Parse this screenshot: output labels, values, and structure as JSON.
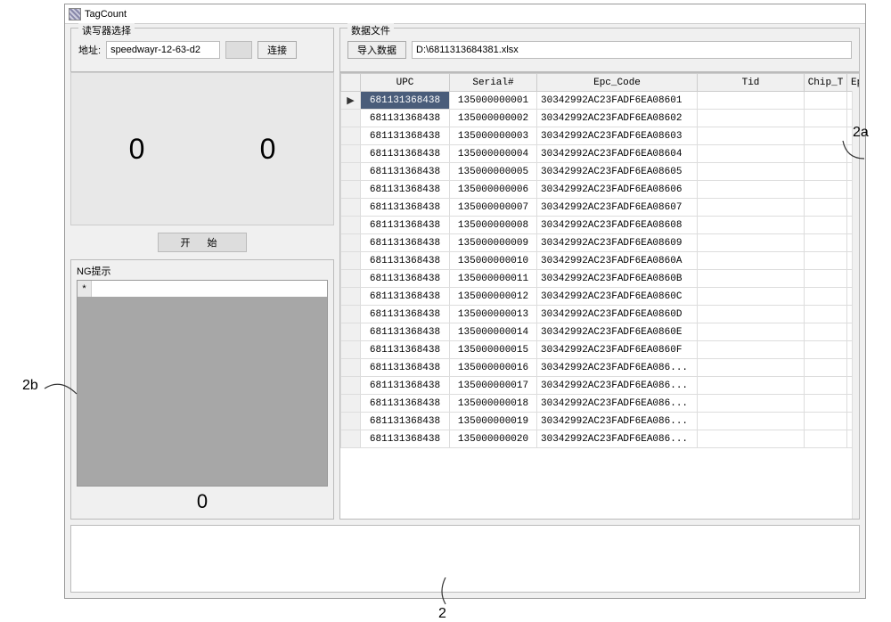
{
  "window": {
    "title": "TagCount"
  },
  "reader": {
    "group_label": "读写器选择",
    "addr_label": "地址:",
    "addr_value": "speedwayr-12-63-d2",
    "connect_label": "连接"
  },
  "datafile": {
    "group_label": "数据文件",
    "import_label": "导入数据",
    "path_value": "D:\\6811313684381.xlsx"
  },
  "counts": {
    "left": "0",
    "right": "0"
  },
  "start_label": "开  始",
  "ng": {
    "title": "NG提示",
    "count": "0",
    "marker": "*"
  },
  "grid": {
    "columns": [
      "",
      "UPC",
      "Serial#",
      "Epc_Code",
      "Tid",
      "Chip_T",
      "Epc_L"
    ],
    "rows": [
      {
        "marker": "▶",
        "upc": "681131368438",
        "serial": "135000000001",
        "epc": "30342992AC23FADF6EA08601",
        "sel": true
      },
      {
        "marker": "",
        "upc": "681131368438",
        "serial": "135000000002",
        "epc": "30342992AC23FADF6EA08602"
      },
      {
        "marker": "",
        "upc": "681131368438",
        "serial": "135000000003",
        "epc": "30342992AC23FADF6EA08603"
      },
      {
        "marker": "",
        "upc": "681131368438",
        "serial": "135000000004",
        "epc": "30342992AC23FADF6EA08604"
      },
      {
        "marker": "",
        "upc": "681131368438",
        "serial": "135000000005",
        "epc": "30342992AC23FADF6EA08605"
      },
      {
        "marker": "",
        "upc": "681131368438",
        "serial": "135000000006",
        "epc": "30342992AC23FADF6EA08606"
      },
      {
        "marker": "",
        "upc": "681131368438",
        "serial": "135000000007",
        "epc": "30342992AC23FADF6EA08607"
      },
      {
        "marker": "",
        "upc": "681131368438",
        "serial": "135000000008",
        "epc": "30342992AC23FADF6EA08608"
      },
      {
        "marker": "",
        "upc": "681131368438",
        "serial": "135000000009",
        "epc": "30342992AC23FADF6EA08609"
      },
      {
        "marker": "",
        "upc": "681131368438",
        "serial": "135000000010",
        "epc": "30342992AC23FADF6EA0860A"
      },
      {
        "marker": "",
        "upc": "681131368438",
        "serial": "135000000011",
        "epc": "30342992AC23FADF6EA0860B"
      },
      {
        "marker": "",
        "upc": "681131368438",
        "serial": "135000000012",
        "epc": "30342992AC23FADF6EA0860C"
      },
      {
        "marker": "",
        "upc": "681131368438",
        "serial": "135000000013",
        "epc": "30342992AC23FADF6EA0860D"
      },
      {
        "marker": "",
        "upc": "681131368438",
        "serial": "135000000014",
        "epc": "30342992AC23FADF6EA0860E"
      },
      {
        "marker": "",
        "upc": "681131368438",
        "serial": "135000000015",
        "epc": "30342992AC23FADF6EA0860F"
      },
      {
        "marker": "",
        "upc": "681131368438",
        "serial": "135000000016",
        "epc": "30342992AC23FADF6EA086..."
      },
      {
        "marker": "",
        "upc": "681131368438",
        "serial": "135000000017",
        "epc": "30342992AC23FADF6EA086..."
      },
      {
        "marker": "",
        "upc": "681131368438",
        "serial": "135000000018",
        "epc": "30342992AC23FADF6EA086..."
      },
      {
        "marker": "",
        "upc": "681131368438",
        "serial": "135000000019",
        "epc": "30342992AC23FADF6EA086..."
      },
      {
        "marker": "",
        "upc": "681131368438",
        "serial": "135000000020",
        "epc": "30342992AC23FADF6EA086..."
      }
    ]
  },
  "annotations": {
    "a2a": "2a",
    "a2b": "2b",
    "a2": "2"
  }
}
